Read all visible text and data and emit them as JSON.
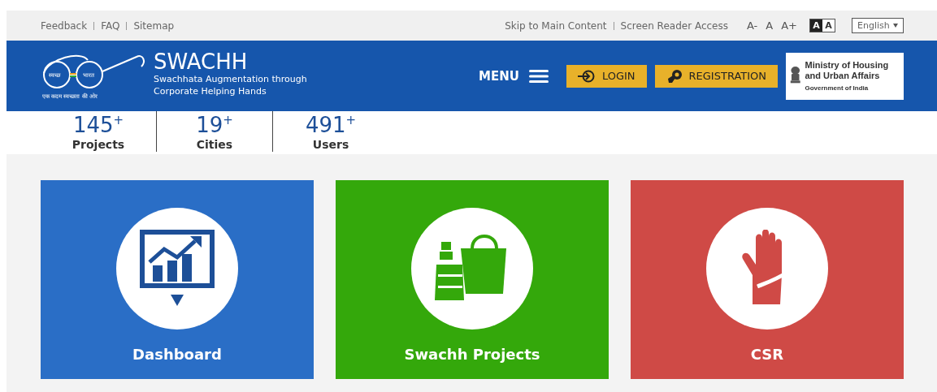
{
  "top_bar": {
    "links": [
      "Feedback",
      "FAQ",
      "Sitemap"
    ],
    "access_links": [
      "Skip to Main Content",
      "Screen Reader Access"
    ],
    "font_sizes": [
      "A-",
      "A",
      "A+"
    ],
    "contrast": [
      {
        "label": "A",
        "selected": true
      },
      {
        "label": "A",
        "selected": false
      }
    ],
    "language": "English"
  },
  "header": {
    "logo_texts": [
      "स्वच्छ",
      "भारत",
      "एक कदम स्वच्छता की ओर"
    ],
    "title": "SWACHH",
    "subtitle": "Swachhata Augmentation through Corporate Helping Hands",
    "menu": "MENU",
    "buttons": [
      {
        "label": "LOGIN",
        "kind": "login"
      },
      {
        "label": "REGISTRATION",
        "kind": "register"
      }
    ],
    "ministry": {
      "name": "Ministry of Housing and Urban Affairs",
      "government": "Government of India"
    }
  },
  "stats": [
    {
      "value": "145",
      "suffix": "+",
      "label": "Projects"
    },
    {
      "value": "19",
      "suffix": "+",
      "label": "Cities"
    },
    {
      "value": "491",
      "suffix": "+",
      "label": "Users"
    }
  ],
  "cards": [
    {
      "label": "Dashboard",
      "kind": "dashboard",
      "color": "#2a6ec6"
    },
    {
      "label": "Swachh Projects",
      "kind": "projects",
      "color": "#34a80b"
    },
    {
      "label": "CSR",
      "kind": "csr",
      "color": "#cf4a46"
    }
  ]
}
